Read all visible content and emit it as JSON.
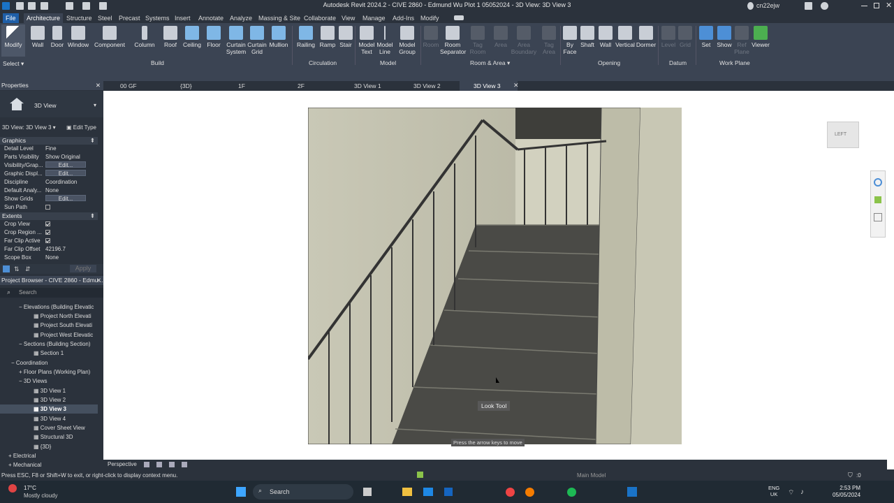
{
  "app": {
    "title": "Autodesk Revit 2024.2 - CIVE 2860 - Edmund Wu Plot 1 05052024 - 3D View: 3D View 3",
    "user": "cn22ejw"
  },
  "menu": [
    "File",
    "Architecture",
    "Structure",
    "Steel",
    "Precast",
    "Systems",
    "Insert",
    "Annotate",
    "Analyze",
    "Massing & Site",
    "Collaborate",
    "View",
    "Manage",
    "Add-Ins",
    "Modify"
  ],
  "ribbon": {
    "tools": [
      "Modify",
      "Wall",
      "Door",
      "Window",
      "Component",
      "Column",
      "Roof",
      "Ceiling",
      "Floor",
      "Curtain System",
      "Curtain Grid",
      "Mullion",
      "Railing",
      "Ramp",
      "Stair",
      "Model Text",
      "Model Line",
      "Model Group",
      "Room",
      "Room Separator",
      "Tag Room",
      "Area",
      "Area Boundary",
      "Tag Area",
      "By Face",
      "Shaft",
      "Wall",
      "Vertical",
      "Dormer",
      "Level",
      "Grid",
      "Set",
      "Show",
      "Ref Plane",
      "Viewer"
    ],
    "groups": [
      "Build",
      "Circulation",
      "Model",
      "Room & Area",
      "Opening",
      "Datum",
      "Work Plane"
    ],
    "select": "Select"
  },
  "viewtabs": [
    "00 GF",
    "{3D}",
    "1F",
    "2F",
    "3D View 1",
    "3D View 2",
    "3D View 3"
  ],
  "properties": {
    "title": "Properties",
    "type": "3D View",
    "selector": "3D View: 3D View 3",
    "edit_type": "Edit Type",
    "graphics": "Graphics",
    "extents": "Extents",
    "apply": "Apply",
    "rows": [
      {
        "k": "Detail Level",
        "v": "Fine"
      },
      {
        "k": "Parts Visibility",
        "v": "Show Original"
      },
      {
        "k": "Visibility/Grap...",
        "v": "Edit..."
      },
      {
        "k": "Graphic Displ...",
        "v": "Edit..."
      },
      {
        "k": "Discipline",
        "v": "Coordination"
      },
      {
        "k": "Default Analy...",
        "v": "None"
      },
      {
        "k": "Show Grids",
        "v": "Edit..."
      },
      {
        "k": "Sun Path",
        "v": ""
      }
    ],
    "rows2": [
      {
        "k": "Crop View",
        "v": ""
      },
      {
        "k": "Crop Region ...",
        "v": ""
      },
      {
        "k": "Far Clip Active",
        "v": ""
      },
      {
        "k": "Far Clip Offset",
        "v": "42196.7"
      },
      {
        "k": "Scope Box",
        "v": "None"
      }
    ]
  },
  "browser": {
    "title": "Project Browser - CIVE 2860 - Edmu...",
    "search": "Search",
    "nodes": [
      "Elevations (Building Elevatic",
      "Project North Elevati",
      "Project South Elevati",
      "Project West Elevatic",
      "Sections (Building Section)",
      "Section 1",
      "Coordination",
      "Floor Plans (Working Plan)",
      "3D Views",
      "3D View 1",
      "3D View 2",
      "3D View 3",
      "3D View 4",
      "Cover Sheet View",
      "Structural 3D",
      "{3D}",
      "Electrical",
      "Mechanical"
    ]
  },
  "canvas": {
    "tooltip": "Look Tool",
    "hint": "Press the arrow keys to move",
    "viewcube": "LEFT"
  },
  "viewctrl": {
    "mode": "Perspective"
  },
  "status": {
    "message": "Press ESC, F8 or Shift+W to exit, or right-click to display context menu.",
    "model": "Main Model",
    "filter": ":0"
  },
  "taskbar": {
    "temp": "17°C",
    "weather": "Mostly cloudy",
    "search": "Search",
    "lang1": "ENG",
    "lang2": "UK",
    "time": "2:53 PM",
    "date": "05/05/2024"
  }
}
